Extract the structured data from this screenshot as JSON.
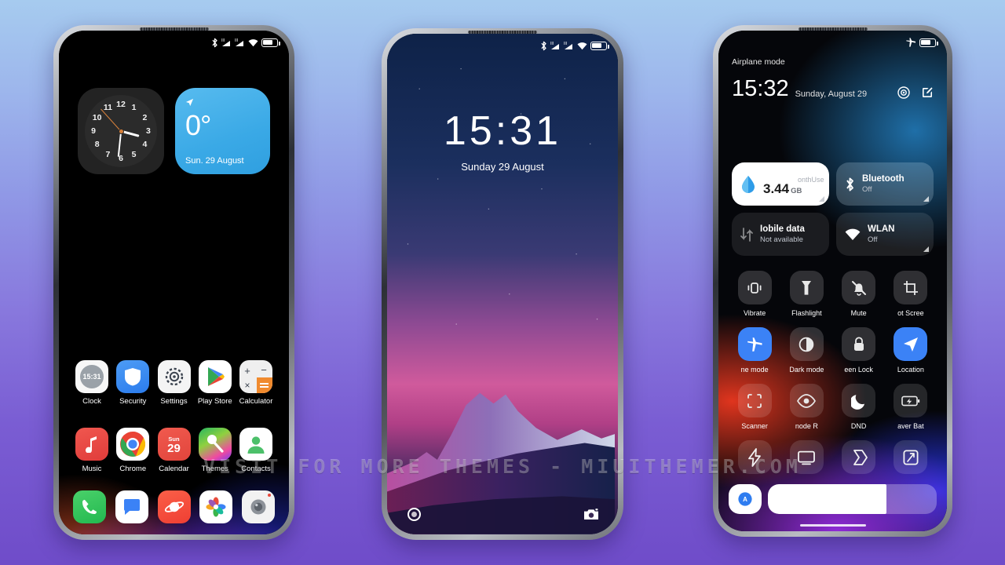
{
  "background": {
    "top_color": "#a6cbef",
    "bottom_color": "#6f4cc9"
  },
  "watermark": {
    "text": "VISIT  FOR  MORE  THEMES  -  MIUITHEMER.COM"
  },
  "phone_left": {
    "name": "home-screen",
    "statusbar": {
      "icons": [
        "bluetooth-icon",
        "signal-1-icon",
        "signal-2-icon",
        "wifi-icon",
        "battery-icon"
      ]
    },
    "clock_widget": {
      "numerals": [
        "12",
        "1",
        "2",
        "3",
        "4",
        "5",
        "6",
        "7",
        "8",
        "9",
        "10",
        "11"
      ],
      "time_shown": "3:31"
    },
    "weather_widget": {
      "temperature": "0°",
      "date": "Sun. 29 August",
      "location_icon": "location-arrow-icon",
      "color": "#3aa9e6"
    },
    "apps_row1": [
      {
        "label": "Clock",
        "icon": "clock-app-icon",
        "badge_time": "15:31"
      },
      {
        "label": "Security",
        "icon": "security-shield-icon"
      },
      {
        "label": "Settings",
        "icon": "settings-gear-icon"
      },
      {
        "label": "Play Store",
        "icon": "play-store-icon"
      },
      {
        "label": "Calculator",
        "icon": "calculator-icon"
      }
    ],
    "apps_row2": [
      {
        "label": "Music",
        "icon": "music-note-icon"
      },
      {
        "label": "Chrome",
        "icon": "chrome-icon"
      },
      {
        "label": "Calendar",
        "icon": "calendar-icon",
        "day_name": "Sun",
        "day_number": "29"
      },
      {
        "label": "Themes",
        "icon": "themes-icon"
      },
      {
        "label": "Contacts",
        "icon": "contacts-person-icon"
      }
    ],
    "dock": [
      {
        "icon": "phone-dialer-icon",
        "label": "Phone"
      },
      {
        "icon": "messages-icon",
        "label": "Messages"
      },
      {
        "icon": "browser-icon",
        "label": "Browser"
      },
      {
        "icon": "gallery-icon",
        "label": "Gallery"
      },
      {
        "icon": "camera-icon",
        "label": "Camera"
      }
    ],
    "cursor": {
      "icon": "hand-pointer-cursor"
    }
  },
  "phone_center": {
    "name": "lock-screen",
    "statusbar": {
      "icons": [
        "bluetooth-icon",
        "signal-1-icon",
        "signal-2-icon",
        "wifi-icon",
        "battery-icon"
      ]
    },
    "time": "15:31",
    "date": "Sunday 29 August",
    "bottom_left": {
      "icon": "unlock-ring-icon"
    },
    "bottom_right": {
      "icon": "camera-shortcut-icon"
    }
  },
  "phone_right": {
    "name": "control-center",
    "statusbar": {
      "label": "Airplane mode",
      "icons": [
        "airplane-icon",
        "battery-icon"
      ]
    },
    "time": "15:32",
    "date": "Sunday, August 29",
    "actions": [
      {
        "icon": "settings-target-icon"
      },
      {
        "icon": "edit-pencil-icon"
      }
    ],
    "big_tiles": [
      {
        "name": "data-usage",
        "header_left": "onth",
        "header_right": "Use",
        "value": "3.44",
        "unit": "GB",
        "icon": "data-drop-icon",
        "active": true
      },
      {
        "name": "bluetooth",
        "title": "Bluetooth",
        "subtitle": "Off",
        "icon": "bluetooth-icon",
        "active": true
      },
      {
        "name": "mobile-data",
        "title": "Iobile data",
        "subtitle": "Not available",
        "icon": "mobile-data-icon",
        "active": false
      },
      {
        "name": "wlan",
        "title": "WLAN",
        "subtitle": "Off",
        "icon": "wifi-icon",
        "active": false
      }
    ],
    "toggles": [
      {
        "label": "Vibrate",
        "icon": "vibrate-icon",
        "state": "off"
      },
      {
        "label": "Flashlight",
        "icon": "flashlight-icon",
        "state": "off"
      },
      {
        "label": "Mute",
        "icon": "mute-bell-icon",
        "state": "off"
      },
      {
        "label": "ot   Scree",
        "icon": "screenshot-icon",
        "state": "off"
      },
      {
        "label": "ne mode",
        "icon": "airplane-icon",
        "state": "on"
      },
      {
        "label": "Dark mode",
        "icon": "dark-mode-icon",
        "state": "off"
      },
      {
        "label": "een   Lock",
        "icon": "lock-icon",
        "state": "off"
      },
      {
        "label": "Location",
        "icon": "location-arrow-icon",
        "state": "on"
      },
      {
        "label": "Scanner",
        "icon": "scanner-icon",
        "state": "off"
      },
      {
        "label": "node   R",
        "icon": "reading-eye-icon",
        "state": "off"
      },
      {
        "label": "DND",
        "icon": "dnd-moon-icon",
        "state": "off"
      },
      {
        "label": "aver   Bat",
        "icon": "battery-saver-icon",
        "state": "off"
      },
      {
        "label": "",
        "icon": "ultra-power-icon",
        "state": "off"
      },
      {
        "label": "",
        "icon": "cast-screen-icon",
        "state": "off"
      },
      {
        "label": "",
        "icon": "second-space-icon",
        "state": "off"
      },
      {
        "label": "",
        "icon": "sync-rotate-icon",
        "state": "off"
      }
    ],
    "brightness": {
      "auto_icon": "auto-brightness-icon",
      "level_percent": 70
    }
  }
}
